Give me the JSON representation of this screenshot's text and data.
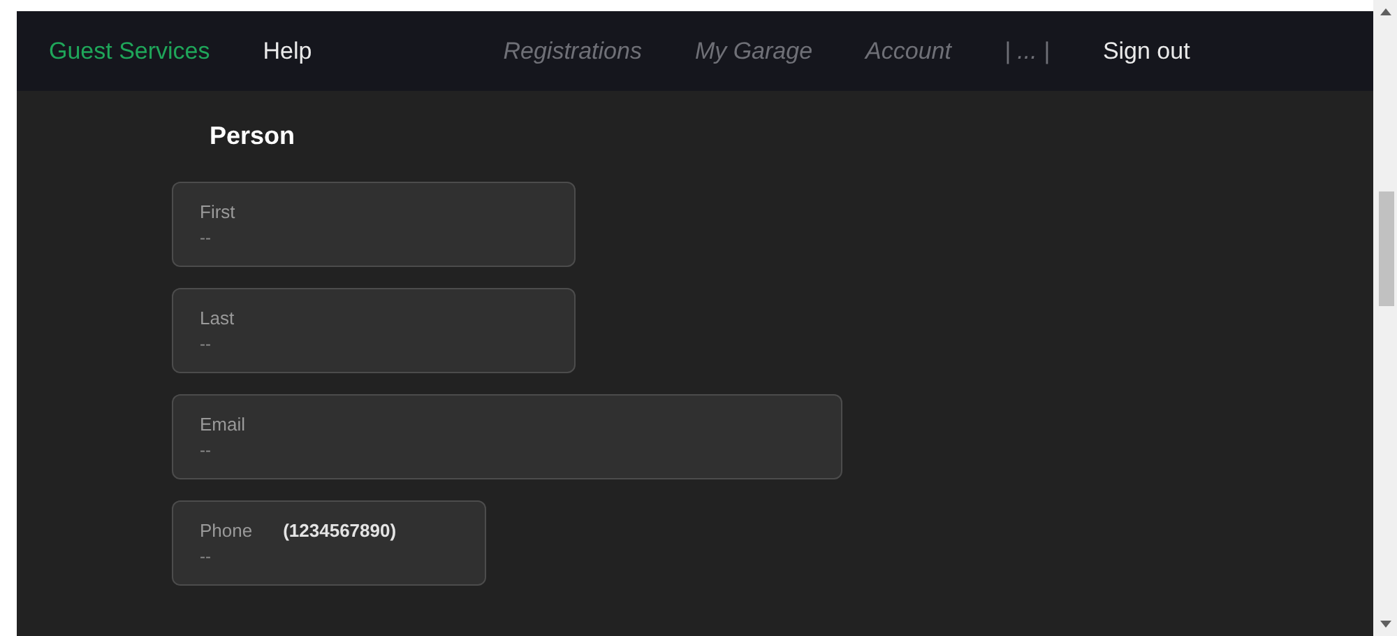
{
  "nav": {
    "items": [
      {
        "label": "Guest Services",
        "selected": true,
        "disabled": false
      },
      {
        "label": "Help",
        "selected": false,
        "disabled": false
      },
      {
        "label": "Registrations",
        "selected": false,
        "disabled": true
      },
      {
        "label": "My Garage",
        "selected": false,
        "disabled": true
      },
      {
        "label": "Account",
        "selected": false,
        "disabled": true
      },
      {
        "label": "| ... |",
        "selected": false,
        "disabled": true
      },
      {
        "label": "Sign out",
        "selected": false,
        "disabled": false
      }
    ]
  },
  "section": {
    "title": "Person",
    "fields": [
      {
        "kind": "name",
        "label": "First",
        "value": "--"
      },
      {
        "kind": "name",
        "label": "Last",
        "value": "--"
      },
      {
        "kind": "email",
        "label": "Email",
        "value": "--"
      },
      {
        "kind": "phone",
        "label": "Phone",
        "hint": "(1234567890)",
        "value": "--"
      }
    ]
  }
}
